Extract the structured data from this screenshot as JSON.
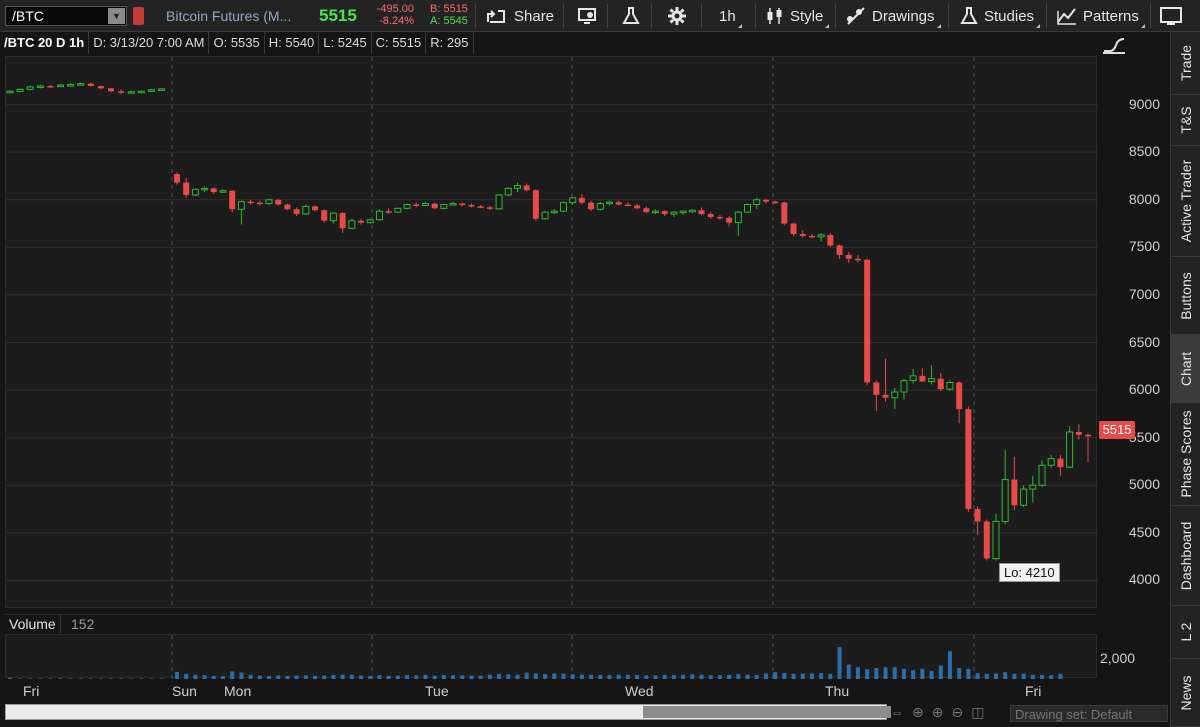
{
  "toolbar": {
    "symbol": "/BTC",
    "description": "Bitcoin Futures (M...",
    "last": "5515",
    "net_change": "-495.00",
    "pct_change": "-8.24%",
    "bid": "B: 5515",
    "ask": "A: 5545",
    "share_label": "Share",
    "timeframe": "1h",
    "style_label": "Style",
    "drawings_label": "Drawings",
    "studies_label": "Studies",
    "patterns_label": "Patterns"
  },
  "infobar": {
    "title": "/BTC 20 D 1h",
    "date": "D: 3/13/20 7:00 AM",
    "open": "O: 5535",
    "high": "H: 5540",
    "low": "L: 5245",
    "close": "C: 5515",
    "range": "R: 295"
  },
  "price_axis": [
    "9000",
    "8500",
    "8000",
    "7500",
    "7000",
    "6500",
    "6000",
    "5500",
    "5000",
    "4500",
    "4000"
  ],
  "current_price_tag": "5515",
  "low_tag": "Lo: 4210",
  "volume": {
    "label": "Volume",
    "value": "152",
    "axis_label": "2,000"
  },
  "date_axis": [
    "Fri",
    "Sun",
    "Mon",
    "Tue",
    "Wed",
    "Thu",
    "Fri"
  ],
  "bottom": {
    "drawing_set": "Drawing set: Default"
  },
  "right_tabs": [
    "Trade",
    "T&S",
    "Active Trader",
    "Buttons",
    "Chart",
    "Phase Scores",
    "Dashboard",
    "L 2",
    "News"
  ],
  "colors": {
    "up": "#2fb82f",
    "down": "#e84a4a",
    "volume": "#2a6fa8",
    "grid": "#3a3a3a"
  },
  "chart_data": {
    "type": "candlestick",
    "title": "/BTC 20 D 1h",
    "ylim": [
      3700,
      9500
    ],
    "candles": [
      {
        "o": 9130,
        "h": 9150,
        "l": 9120,
        "c": 9140
      },
      {
        "o": 9140,
        "h": 9170,
        "l": 9130,
        "c": 9160
      },
      {
        "o": 9160,
        "h": 9200,
        "l": 9150,
        "c": 9185
      },
      {
        "o": 9185,
        "h": 9210,
        "l": 9170,
        "c": 9195
      },
      {
        "o": 9195,
        "h": 9205,
        "l": 9180,
        "c": 9190
      },
      {
        "o": 9190,
        "h": 9215,
        "l": 9185,
        "c": 9205
      },
      {
        "o": 9205,
        "h": 9225,
        "l": 9195,
        "c": 9210
      },
      {
        "o": 9210,
        "h": 9230,
        "l": 9200,
        "c": 9220
      },
      {
        "o": 9220,
        "h": 9230,
        "l": 9190,
        "c": 9195
      },
      {
        "o": 9195,
        "h": 9200,
        "l": 9160,
        "c": 9170
      },
      {
        "o": 9170,
        "h": 9175,
        "l": 9130,
        "c": 9140
      },
      {
        "o": 9140,
        "h": 9160,
        "l": 9110,
        "c": 9125
      },
      {
        "o": 9125,
        "h": 9145,
        "l": 9115,
        "c": 9135
      },
      {
        "o": 9135,
        "h": 9150,
        "l": 9125,
        "c": 9140
      },
      {
        "o": 9140,
        "h": 9165,
        "l": 9135,
        "c": 9155
      },
      {
        "o": 9155,
        "h": 9170,
        "l": 9150,
        "c": 9165
      },
      {
        "o": 8270,
        "h": 8290,
        "l": 8160,
        "c": 8180
      },
      {
        "o": 8180,
        "h": 8230,
        "l": 8020,
        "c": 8050
      },
      {
        "o": 8050,
        "h": 8120,
        "l": 8040,
        "c": 8110
      },
      {
        "o": 8110,
        "h": 8140,
        "l": 8080,
        "c": 8120
      },
      {
        "o": 8120,
        "h": 8130,
        "l": 8060,
        "c": 8080
      },
      {
        "o": 8080,
        "h": 8110,
        "l": 8070,
        "c": 8095
      },
      {
        "o": 8095,
        "h": 8100,
        "l": 7870,
        "c": 7900
      },
      {
        "o": 7900,
        "h": 7990,
        "l": 7740,
        "c": 7980
      },
      {
        "o": 7980,
        "h": 8000,
        "l": 7950,
        "c": 7970
      },
      {
        "o": 7970,
        "h": 7990,
        "l": 7940,
        "c": 7960
      },
      {
        "o": 7960,
        "h": 8010,
        "l": 7950,
        "c": 8000
      },
      {
        "o": 8000,
        "h": 8010,
        "l": 7940,
        "c": 7950
      },
      {
        "o": 7950,
        "h": 7960,
        "l": 7890,
        "c": 7900
      },
      {
        "o": 7900,
        "h": 7920,
        "l": 7830,
        "c": 7850
      },
      {
        "o": 7850,
        "h": 7950,
        "l": 7840,
        "c": 7930
      },
      {
        "o": 7930,
        "h": 7940,
        "l": 7880,
        "c": 7890
      },
      {
        "o": 7890,
        "h": 7900,
        "l": 7760,
        "c": 7780
      },
      {
        "o": 7780,
        "h": 7870,
        "l": 7750,
        "c": 7860
      },
      {
        "o": 7860,
        "h": 7870,
        "l": 7650,
        "c": 7700
      },
      {
        "o": 7700,
        "h": 7800,
        "l": 7690,
        "c": 7780
      },
      {
        "o": 7780,
        "h": 7800,
        "l": 7740,
        "c": 7760
      },
      {
        "o": 7760,
        "h": 7800,
        "l": 7750,
        "c": 7790
      },
      {
        "o": 7790,
        "h": 7900,
        "l": 7780,
        "c": 7880
      },
      {
        "o": 7880,
        "h": 7910,
        "l": 7850,
        "c": 7870
      },
      {
        "o": 7870,
        "h": 7920,
        "l": 7860,
        "c": 7910
      },
      {
        "o": 7910,
        "h": 7960,
        "l": 7900,
        "c": 7950
      },
      {
        "o": 7950,
        "h": 7970,
        "l": 7920,
        "c": 7940
      },
      {
        "o": 7940,
        "h": 7980,
        "l": 7930,
        "c": 7960
      },
      {
        "o": 7960,
        "h": 7970,
        "l": 7900,
        "c": 7910
      },
      {
        "o": 7910,
        "h": 7960,
        "l": 7900,
        "c": 7950
      },
      {
        "o": 7950,
        "h": 7980,
        "l": 7940,
        "c": 7960
      },
      {
        "o": 7960,
        "h": 7970,
        "l": 7930,
        "c": 7945
      },
      {
        "o": 7945,
        "h": 7960,
        "l": 7920,
        "c": 7930
      },
      {
        "o": 7930,
        "h": 7945,
        "l": 7910,
        "c": 7920
      },
      {
        "o": 7920,
        "h": 7940,
        "l": 7890,
        "c": 7905
      },
      {
        "o": 7905,
        "h": 8060,
        "l": 7895,
        "c": 8050
      },
      {
        "o": 8050,
        "h": 8130,
        "l": 8040,
        "c": 8120
      },
      {
        "o": 8120,
        "h": 8180,
        "l": 8080,
        "c": 8150
      },
      {
        "o": 8150,
        "h": 8170,
        "l": 8090,
        "c": 8100
      },
      {
        "o": 8100,
        "h": 8110,
        "l": 7780,
        "c": 7800
      },
      {
        "o": 7800,
        "h": 7880,
        "l": 7790,
        "c": 7870
      },
      {
        "o": 7870,
        "h": 7900,
        "l": 7850,
        "c": 7880
      },
      {
        "o": 7880,
        "h": 7980,
        "l": 7870,
        "c": 7970
      },
      {
        "o": 7970,
        "h": 8030,
        "l": 7950,
        "c": 8020
      },
      {
        "o": 8020,
        "h": 8060,
        "l": 7950,
        "c": 7970
      },
      {
        "o": 7970,
        "h": 7990,
        "l": 7880,
        "c": 7900
      },
      {
        "o": 7900,
        "h": 7980,
        "l": 7890,
        "c": 7960
      },
      {
        "o": 7960,
        "h": 7990,
        "l": 7940,
        "c": 7975
      },
      {
        "o": 7975,
        "h": 7990,
        "l": 7940,
        "c": 7950
      },
      {
        "o": 7950,
        "h": 7970,
        "l": 7930,
        "c": 7940
      },
      {
        "o": 7940,
        "h": 7960,
        "l": 7900,
        "c": 7910
      },
      {
        "o": 7910,
        "h": 7930,
        "l": 7860,
        "c": 7870
      },
      {
        "o": 7870,
        "h": 7900,
        "l": 7850,
        "c": 7880
      },
      {
        "o": 7880,
        "h": 7890,
        "l": 7830,
        "c": 7850
      },
      {
        "o": 7850,
        "h": 7880,
        "l": 7820,
        "c": 7870
      },
      {
        "o": 7870,
        "h": 7890,
        "l": 7840,
        "c": 7880
      },
      {
        "o": 7880,
        "h": 7900,
        "l": 7860,
        "c": 7890
      },
      {
        "o": 7890,
        "h": 7920,
        "l": 7840,
        "c": 7850
      },
      {
        "o": 7850,
        "h": 7870,
        "l": 7800,
        "c": 7820
      },
      {
        "o": 7820,
        "h": 7840,
        "l": 7790,
        "c": 7810
      },
      {
        "o": 7810,
        "h": 7830,
        "l": 7720,
        "c": 7760
      },
      {
        "o": 7760,
        "h": 7880,
        "l": 7620,
        "c": 7870
      },
      {
        "o": 7870,
        "h": 7960,
        "l": 7860,
        "c": 7950
      },
      {
        "o": 7950,
        "h": 8020,
        "l": 7900,
        "c": 8000
      },
      {
        "o": 8000,
        "h": 8010,
        "l": 7960,
        "c": 7980
      },
      {
        "o": 7980,
        "h": 7990,
        "l": 7960,
        "c": 7970
      },
      {
        "o": 7970,
        "h": 7980,
        "l": 7730,
        "c": 7750
      },
      {
        "o": 7750,
        "h": 7760,
        "l": 7620,
        "c": 7640
      },
      {
        "o": 7640,
        "h": 7680,
        "l": 7600,
        "c": 7620
      },
      {
        "o": 7620,
        "h": 7640,
        "l": 7600,
        "c": 7610
      },
      {
        "o": 7610,
        "h": 7650,
        "l": 7560,
        "c": 7630
      },
      {
        "o": 7630,
        "h": 7650,
        "l": 7500,
        "c": 7520
      },
      {
        "o": 7520,
        "h": 7530,
        "l": 7380,
        "c": 7420
      },
      {
        "o": 7420,
        "h": 7450,
        "l": 7340,
        "c": 7380
      },
      {
        "o": 7380,
        "h": 7420,
        "l": 7340,
        "c": 7370
      },
      {
        "o": 7370,
        "h": 7380,
        "l": 6050,
        "c": 6080
      },
      {
        "o": 6080,
        "h": 6100,
        "l": 5780,
        "c": 5950
      },
      {
        "o": 5950,
        "h": 6330,
        "l": 5880,
        "c": 5920
      },
      {
        "o": 5920,
        "h": 6020,
        "l": 5800,
        "c": 5980
      },
      {
        "o": 5980,
        "h": 6120,
        "l": 5900,
        "c": 6100
      },
      {
        "o": 6100,
        "h": 6220,
        "l": 6070,
        "c": 6150
      },
      {
        "o": 6150,
        "h": 6230,
        "l": 6100,
        "c": 6090
      },
      {
        "o": 6090,
        "h": 6260,
        "l": 6060,
        "c": 6120
      },
      {
        "o": 6120,
        "h": 6180,
        "l": 5990,
        "c": 6010
      },
      {
        "o": 6010,
        "h": 6100,
        "l": 5990,
        "c": 6080
      },
      {
        "o": 6080,
        "h": 6090,
        "l": 5650,
        "c": 5800
      },
      {
        "o": 5800,
        "h": 5830,
        "l": 4720,
        "c": 4750
      },
      {
        "o": 4750,
        "h": 4780,
        "l": 4480,
        "c": 4620
      },
      {
        "o": 4620,
        "h": 4640,
        "l": 4210,
        "c": 4230
      },
      {
        "o": 4230,
        "h": 4700,
        "l": 4210,
        "c": 4620
      },
      {
        "o": 4620,
        "h": 5370,
        "l": 4590,
        "c": 5060
      },
      {
        "o": 5060,
        "h": 5300,
        "l": 4740,
        "c": 4790
      },
      {
        "o": 4790,
        "h": 5000,
        "l": 4770,
        "c": 4960
      },
      {
        "o": 4960,
        "h": 5100,
        "l": 4820,
        "c": 5000
      },
      {
        "o": 5000,
        "h": 5260,
        "l": 4980,
        "c": 5210
      },
      {
        "o": 5210,
        "h": 5320,
        "l": 5180,
        "c": 5280
      },
      {
        "o": 5280,
        "h": 5320,
        "l": 5100,
        "c": 5190
      },
      {
        "o": 5190,
        "h": 5620,
        "l": 5180,
        "c": 5560
      },
      {
        "o": 5560,
        "h": 5640,
        "l": 5480,
        "c": 5530
      },
      {
        "o": 5530,
        "h": 5545,
        "l": 5245,
        "c": 5515
      }
    ],
    "volume": [
      80,
      30,
      30,
      30,
      30,
      40,
      30,
      30,
      30,
      30,
      30,
      30,
      30,
      30,
      30,
      30,
      420,
      300,
      260,
      220,
      180,
      170,
      450,
      380,
      250,
      200,
      180,
      200,
      180,
      200,
      220,
      190,
      200,
      230,
      260,
      250,
      200,
      180,
      220,
      190,
      200,
      230,
      210,
      250,
      200,
      240,
      220,
      210,
      200,
      190,
      260,
      300,
      280,
      260,
      380,
      330,
      290,
      320,
      310,
      280,
      260,
      250,
      240,
      230,
      260,
      250,
      230,
      220,
      210,
      240,
      230,
      250,
      280,
      260,
      220,
      230,
      250,
      290,
      260,
      240,
      330,
      410,
      360,
      300,
      320,
      330,
      350,
      300,
      1900,
      850,
      700,
      580,
      650,
      700,
      700,
      600,
      520,
      600,
      470,
      800,
      1650,
      650,
      600,
      350,
      300,
      330,
      400,
      300,
      320,
      250,
      230,
      220,
      300
    ]
  }
}
